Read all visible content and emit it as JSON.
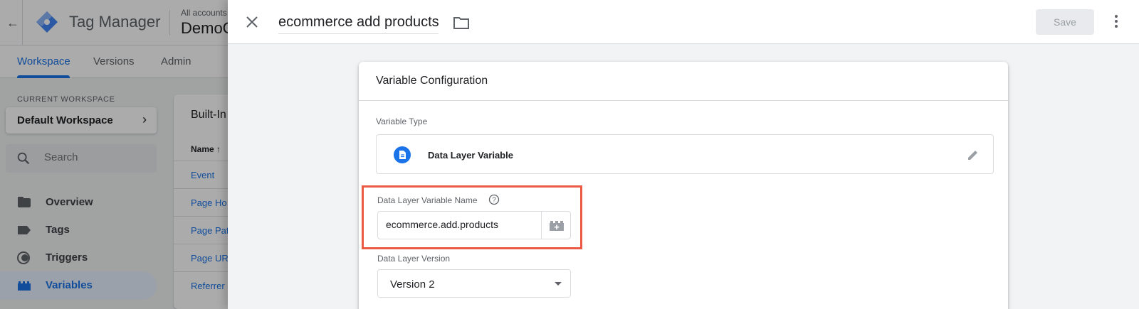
{
  "app": {
    "name": "Tag Manager",
    "account_label": "All accounts",
    "container_name": "DemoC"
  },
  "nav": {
    "tabs": [
      {
        "label": "Workspace",
        "active": true
      },
      {
        "label": "Versions",
        "active": false
      },
      {
        "label": "Admin",
        "active": false
      }
    ]
  },
  "sidebar": {
    "current_workspace_label": "CURRENT WORKSPACE",
    "workspace_name": "Default Workspace",
    "search_placeholder": "Search",
    "items": [
      {
        "label": "Overview",
        "icon": "folder-icon",
        "active": false
      },
      {
        "label": "Tags",
        "icon": "tag-icon",
        "active": false
      },
      {
        "label": "Triggers",
        "icon": "trigger-icon",
        "active": false
      },
      {
        "label": "Variables",
        "icon": "variables-icon",
        "active": true
      }
    ]
  },
  "builtin": {
    "title": "Built-In",
    "name_col": "Name",
    "rows": [
      "Event",
      "Page Ho",
      "Page Pat",
      "Page UR",
      "Referrer"
    ]
  },
  "sheet": {
    "title_value": "ecommerce add products",
    "save_label": "Save",
    "card_title": "Variable Configuration",
    "variable_type_label": "Variable Type",
    "variable_type_name": "Data Layer Variable",
    "dlv_name_label": "Data Layer Variable Name",
    "dlv_name_value": "ecommerce.add.products",
    "dlv_version_label": "Data Layer Version",
    "dlv_version_value": "Version 2"
  },
  "colors": {
    "accent": "#1a73e8",
    "highlight": "#ea5a44"
  }
}
